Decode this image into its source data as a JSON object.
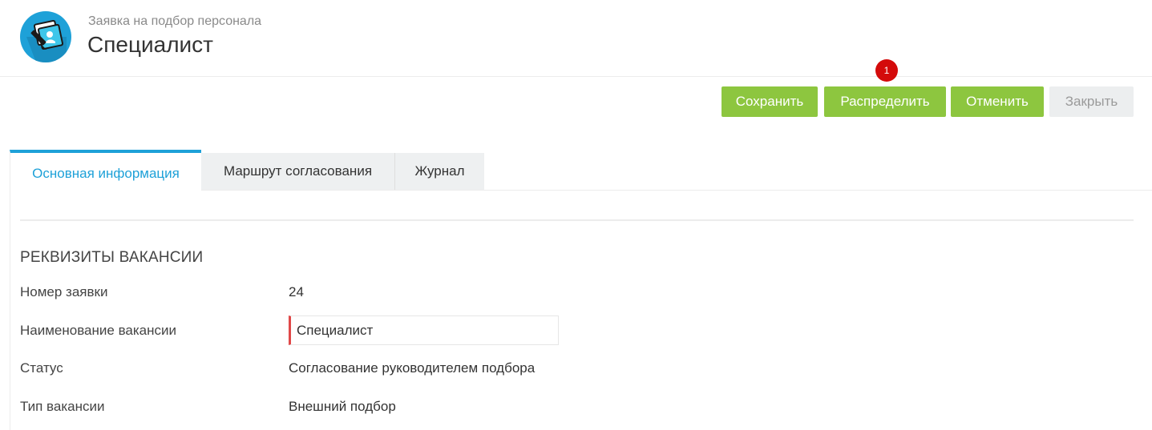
{
  "header": {
    "subtitle": "Заявка на подбор персонала",
    "title": "Специалист",
    "logo_icon": "recruitment-request-icon",
    "logo_color": "#1ea1d8"
  },
  "toolbar": {
    "save_label": "Сохранить",
    "distribute_label": "Распределить",
    "cancel_label": "Отменить",
    "close_label": "Закрыть",
    "primary_color": "#8dc63f",
    "disabled_color": "#eceeef"
  },
  "notification": {
    "count": "1",
    "color": "#d40b0b"
  },
  "tabs": [
    {
      "label": "Основная информация",
      "active": true
    },
    {
      "label": "Маршрут согласования",
      "active": false
    },
    {
      "label": "Журнал",
      "active": false
    }
  ],
  "section": {
    "title": "РЕКВИЗИТЫ ВАКАНСИИ"
  },
  "fields": {
    "number": {
      "label": "Номер заявки",
      "value": "24"
    },
    "vacancy": {
      "label": "Наименование вакансии",
      "value": "Специалист"
    },
    "status": {
      "label": "Статус",
      "value": "Согласование руководителем подбора"
    },
    "type": {
      "label": "Тип вакансии",
      "value": "Внешний подбор"
    }
  }
}
